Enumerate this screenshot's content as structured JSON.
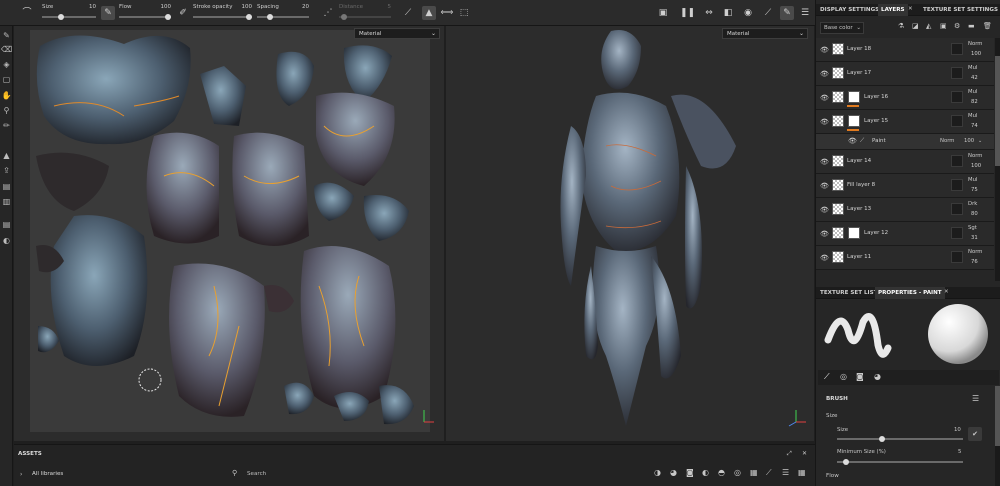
{
  "toolbar": {
    "size_label": "Size",
    "size_value": "10",
    "flow_label": "Flow",
    "flow_value": "100",
    "stroke_opacity_label": "Stroke opacity",
    "stroke_opacity_value": "100",
    "spacing_label": "Spacing",
    "spacing_value": "20",
    "distance_label": "Distance",
    "distance_value": "5"
  },
  "viewport2d": {
    "material_dropdown": "Material"
  },
  "viewport3d": {
    "material_dropdown": "Material"
  },
  "assets": {
    "title": "ASSETS",
    "libraries": "All libraries",
    "search_placeholder": "Search"
  },
  "right_tabs": {
    "display_settings": "DISPLAY SETTINGS",
    "layers": "LAYERS",
    "texture_set_settings": "TEXTURE SET SETTINGS"
  },
  "layers_panel": {
    "channel_dropdown": "Base color",
    "layers": [
      {
        "name": "Layer 18",
        "blend": "Norm",
        "opacity": "100",
        "mask": false,
        "orange": false
      },
      {
        "name": "Layer 17",
        "blend": "Mul",
        "opacity": "42",
        "mask": false,
        "orange": false
      },
      {
        "name": "Layer 16",
        "blend": "Mul",
        "opacity": "82",
        "mask": true,
        "orange": true
      },
      {
        "name": "Layer 15",
        "blend": "Mul",
        "opacity": "74",
        "mask": true,
        "orange": true
      },
      {
        "name": "Paint",
        "blend": "Norm",
        "opacity": "100",
        "sub": true
      },
      {
        "name": "Layer 14",
        "blend": "Norm",
        "opacity": "100",
        "mask": false,
        "orange": false
      },
      {
        "name": "Fill layer 8",
        "blend": "Mul",
        "opacity": "75",
        "mask": false,
        "orange": false
      },
      {
        "name": "Layer 13",
        "blend": "Drk",
        "opacity": "80",
        "mask": false,
        "orange": false
      },
      {
        "name": "Layer 12",
        "blend": "Sgt",
        "opacity": "31",
        "mask": true,
        "orange": false
      },
      {
        "name": "Layer 11",
        "blend": "Norm",
        "opacity": "76",
        "mask": false,
        "orange": false
      }
    ]
  },
  "lower_tabs": {
    "texture_set_list": "TEXTURE SET LIST",
    "properties": "PROPERTIES - PAINT"
  },
  "properties": {
    "brush_title": "BRUSH",
    "size_section": "Size",
    "size_label": "Size",
    "size_value": "10",
    "min_size_label": "Minimum Size (%)",
    "min_size_value": "5",
    "flow_section": "Flow",
    "size_fraction": 0.35,
    "min_size_fraction": 0.05
  },
  "colors": {
    "accent_orange": "#e07a1f",
    "panel_bg": "#262626",
    "viewport_bg": "#2c2c2c"
  }
}
